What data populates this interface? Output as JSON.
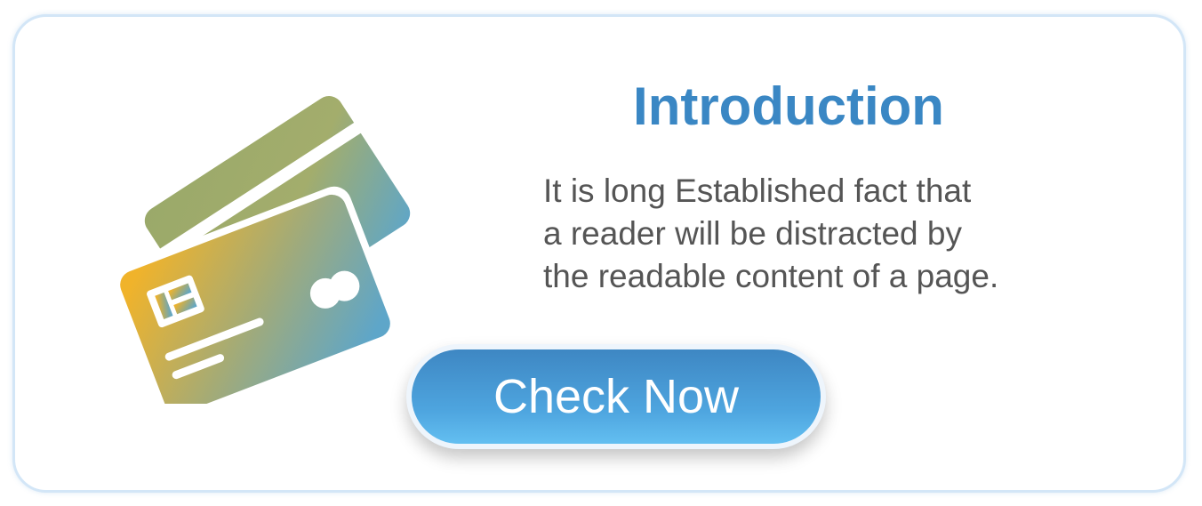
{
  "intro": {
    "title": "Introduction",
    "body_lines": [
      "It is long Established fact that",
      "a reader will be distracted by",
      "the readable content of a page."
    ],
    "cta_label": "Check Now"
  },
  "icons": {
    "illustration": "credit-cards-icon"
  },
  "colors": {
    "title": "#3a87c4",
    "body_text": "#555555",
    "card_border": "#d3e6f7",
    "gradient_gold": "#f0b32b",
    "gradient_teal": "#5ea6c9",
    "button_top": "#3e87c3",
    "button_bottom": "#63bff1"
  }
}
